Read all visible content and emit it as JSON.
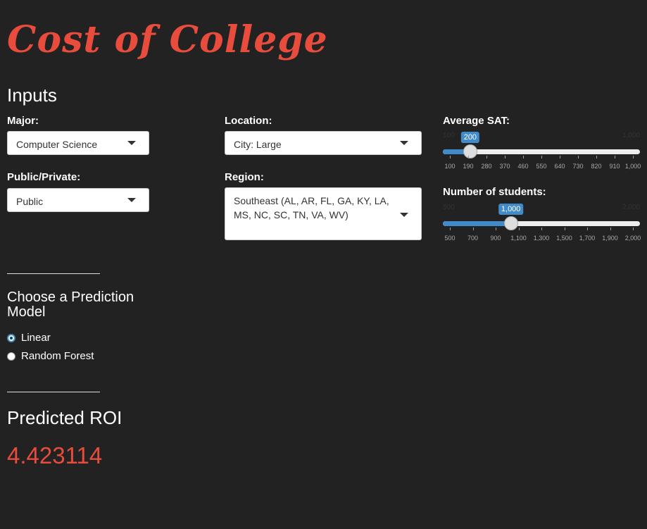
{
  "app": {
    "title": "Cost of College"
  },
  "inputs": {
    "heading": "Inputs",
    "major": {
      "label": "Major:",
      "value": "Computer Science"
    },
    "public_private": {
      "label": "Public/Private:",
      "value": "Public"
    },
    "location": {
      "label": "Location:",
      "value": "City: Large"
    },
    "region": {
      "label": "Region:",
      "value": "Southeast (AL, AR, FL, GA, KY, LA, MS, NC, SC, TN, VA, WV)"
    },
    "avg_sat": {
      "label": "Average SAT:",
      "min": 100,
      "max": 1000,
      "value": 200,
      "min_label": "100",
      "max_label": "1,000",
      "value_label": "200",
      "tick_labels": [
        "100",
        "190",
        "280",
        "370",
        "460",
        "550",
        "640",
        "730",
        "820",
        "910",
        "1,000"
      ]
    },
    "num_students": {
      "label": "Number of students:",
      "min": 500,
      "max": 2000,
      "value": 1000,
      "min_label": "500",
      "max_label": "2,000",
      "value_label": "1,000",
      "tick_labels": [
        "500",
        "700",
        "900",
        "1,100",
        "1,300",
        "1,500",
        "1,700",
        "1,900",
        "2,000"
      ]
    }
  },
  "model": {
    "heading": "Choose a Prediction Model",
    "options": [
      {
        "label": "Linear",
        "selected": true
      },
      {
        "label": "Random Forest",
        "selected": false
      }
    ]
  },
  "result": {
    "heading": "Predicted ROI",
    "value": "4.423114"
  },
  "colors": {
    "background": "#222222",
    "accent": "#e84c3d",
    "slider": "#428bca"
  }
}
